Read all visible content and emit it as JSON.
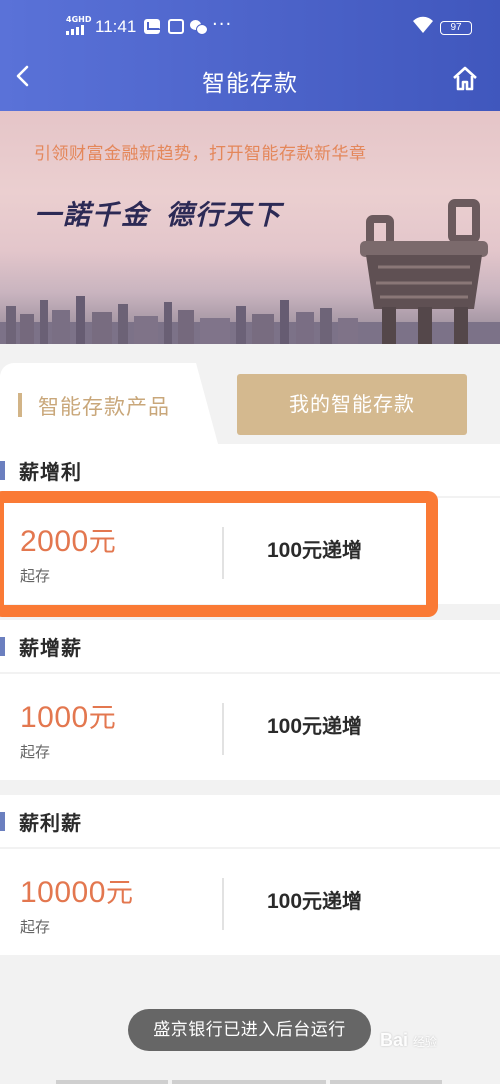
{
  "status_bar": {
    "network": "4GHD",
    "time": "11:41",
    "more": "···",
    "battery": "97"
  },
  "header": {
    "title": "智能存款",
    "back_icon": "back-arrow-icon",
    "home_icon": "home-icon"
  },
  "banner": {
    "slogan": "引领财富金融新趋势，打开智能存款新华章",
    "calligraphy_1": "一諾千金",
    "calligraphy_2": "德行天下"
  },
  "tabs": {
    "active": "智能存款产品",
    "other": "我的智能存款"
  },
  "products": [
    {
      "name": "薪增利",
      "amount_number": "2000",
      "amount_unit": "元",
      "min_label": "起存",
      "increment_number": "100",
      "increment_text": "元递增"
    },
    {
      "name": "薪增薪",
      "amount_number": "1000",
      "amount_unit": "元",
      "min_label": "起存",
      "increment_number": "100",
      "increment_text": "元递增"
    },
    {
      "name": "薪利薪",
      "amount_number": "10000",
      "amount_unit": "元",
      "min_label": "起存",
      "increment_number": "100",
      "increment_text": "元递增"
    }
  ],
  "toast": "盛京银行已进入后台运行",
  "watermark": {
    "brand": "Bai",
    "suffix": "经验"
  },
  "colors": {
    "header_blue": "#4c63c9",
    "gold": "#d4b98f",
    "amount_orange": "#e3774f",
    "highlight_orange": "#fa7a35"
  }
}
